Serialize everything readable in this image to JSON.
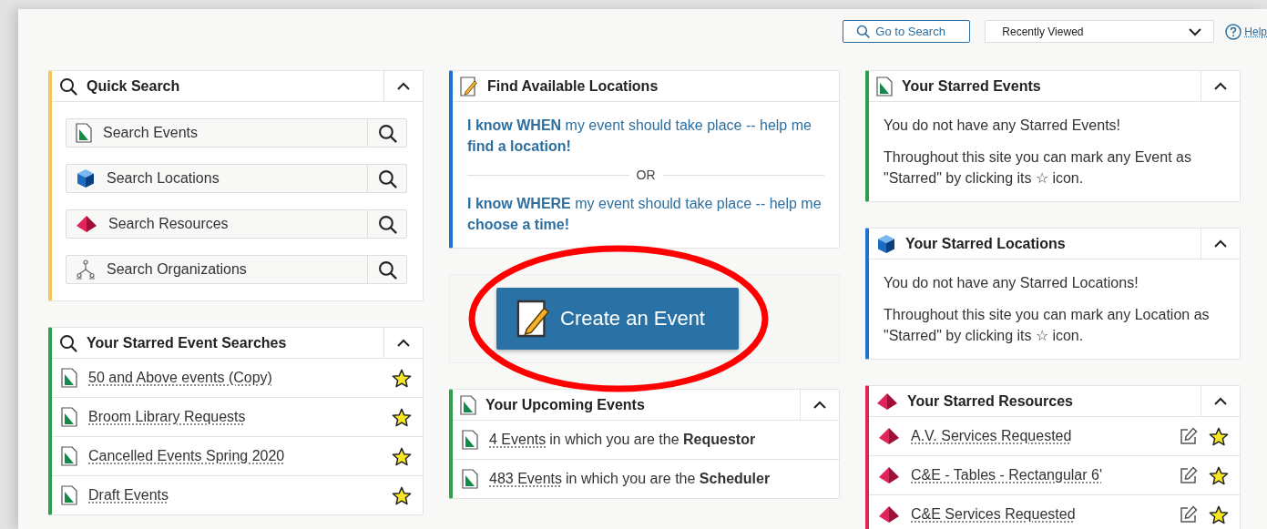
{
  "toolbar": {
    "search_button": "Go to Search",
    "recent_select": "Recently Viewed",
    "help_link": "Help"
  },
  "quick_search": {
    "title": "Quick Search",
    "expanded": true,
    "items": [
      {
        "label": "Search Events",
        "kind": "event"
      },
      {
        "label": "Search Locations",
        "kind": "location"
      },
      {
        "label": "Search Resources",
        "kind": "resource"
      },
      {
        "label": "Search Organizations",
        "kind": "organization"
      }
    ]
  },
  "starred_searches": {
    "title": "Your Starred Event Searches",
    "expanded": true,
    "rows": [
      {
        "label": "50 and Above events (Copy)",
        "starred": true
      },
      {
        "label": "Broom Library Requests",
        "starred": true
      },
      {
        "label": "Cancelled Events Spring 2020",
        "starred": true
      },
      {
        "label": "Draft Events",
        "starred": true
      }
    ]
  },
  "find_locations": {
    "title": "Find Available Locations",
    "when_prompt": "**I know WHEN** my event should take place -- help me **find a location!**",
    "separator": "OR",
    "where_prompt": "**I know WHERE** my event should take place -- help me **choose a time!**"
  },
  "create_event": {
    "label": "Create an Event",
    "highlighted": true
  },
  "upcoming_events": {
    "title": "Your Upcoming Events",
    "expanded": true,
    "rows": [
      {
        "link": "4 Events",
        "rest": "in which you are the **Requestor**"
      },
      {
        "link": "483 Events",
        "rest": "in which you are the **Scheduler**"
      }
    ]
  },
  "starred_events": {
    "title": "Your Starred Events",
    "expanded": true,
    "empty": "You do not have any Starred Events!",
    "hint": "Throughout this site you can mark any Event as \"Starred\" by clicking its ☆ icon."
  },
  "starred_locations": {
    "title": "Your Starred Locations",
    "expanded": true,
    "empty": "You do not have any Starred Locations!",
    "hint": "Throughout this site you can mark any Location as \"Starred\" by clicking its ☆ icon."
  },
  "starred_resources": {
    "title": "Your Starred Resources",
    "expanded": true,
    "rows": [
      {
        "label": "A.V. Services Requested",
        "starred": true
      },
      {
        "label": "C&E - Tables - Rectangular 6'",
        "starred": true
      },
      {
        "label": "C&E Services Requested",
        "starred": true
      }
    ]
  }
}
